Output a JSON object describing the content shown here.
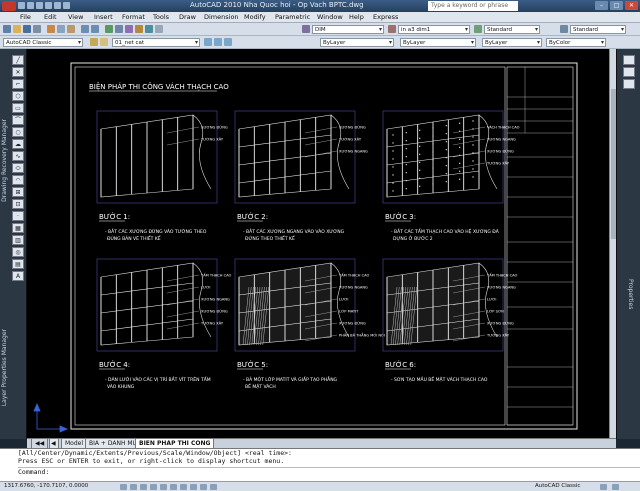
{
  "window": {
    "title": "AutoCAD 2010  Nha Quoc hoi - Op Vach BPTC.dwg",
    "search_placeholder": "Type a keyword or phrase",
    "minimize": "–",
    "maximize": "□",
    "close": "✕"
  },
  "menu": [
    "File",
    "Edit",
    "View",
    "Insert",
    "Format",
    "Tools",
    "Draw",
    "Dimension",
    "Modify",
    "Parametric",
    "Window",
    "Help",
    "Express"
  ],
  "toolbar": {
    "dimstyle": "DIM",
    "textstyle": "in a3 dim1",
    "tablestyle": "Standard",
    "mleaderstyle": "Standard",
    "workspace": "AutoCAD Classic",
    "layer": "01_net cat",
    "color": "ByLayer",
    "linetype": "ByLayer",
    "lineweight": "ByLayer",
    "plotstyle": "ByColor"
  },
  "palettes": {
    "left_top": "Drawing Recovery Manager",
    "left_bottom": "Layer Properties Manager",
    "right": "Properties",
    "text_tool": "A"
  },
  "drawing": {
    "sheet_title": "BIỆN PHÁP THI CÔNG VÁCH THẠCH CAO",
    "steps": [
      {
        "label": "BƯỚC 1:",
        "desc1": "- BẮT CÁC XƯƠNG ĐỨNG VÀO TƯỜNG THEO",
        "desc2": "ĐÚNG BẢN VẼ THIẾT KẾ",
        "callouts": [
          "XƯƠNG ĐỨNG",
          "TƯỜNG XÂY"
        ]
      },
      {
        "label": "BƯỚC 2:",
        "desc1": "- BẮT CÁC XƯƠNG NGANG VÀO VÀO XƯƠNG",
        "desc2": "ĐỨNG THEO THIẾT KẾ",
        "callouts": [
          "XƯƠNG ĐỨNG",
          "TƯỜNG XÂY",
          "XƯƠNG NGANG"
        ]
      },
      {
        "label": "BƯỚC 3:",
        "desc1": "- BẮT CÁC TẤM THẠCH CAO VÀO HỆ XƯƠNG ĐÃ",
        "desc2": "DỰNG Ở BƯỚC 2",
        "callouts": [
          "VÁCH THẠCH CAO",
          "XƯƠNG NGANG",
          "XƯƠNG ĐỨNG",
          "TƯỜNG XÂY"
        ]
      },
      {
        "label": "BƯỚC 4:",
        "desc1": "- DÁN LƯỚI VÀO CÁC VỊ TRÍ BẮT VÍT TRÊN TẤM",
        "desc2": "VÀO KHUNG",
        "callouts": [
          "TẤM THẠCH CAO",
          "LƯỚI",
          "XƯƠNG NGANG",
          "XƯƠNG ĐỨNG",
          "TƯỜNG XÂY"
        ]
      },
      {
        "label": "BƯỚC 5:",
        "desc1": "- BẢ MỘT LỚP MATIT VÀ GIẤP TẠO PHẲNG",
        "desc2": "BỀ MẶT VÁCH",
        "callouts": [
          "TẤM THẠCH CAO",
          "XƯƠNG NGANG",
          "LƯỚI",
          "LỚP MATIT",
          "XƯƠNG ĐỨNG",
          "PHẦN BẢ THẲNG MỐI NỐI"
        ]
      },
      {
        "label": "BƯỚC 6:",
        "desc1": "- SƠN TẠO MẦU BỀ MẶT VÁCH THẠCH CAO",
        "desc2": "",
        "callouts": [
          "TẤM THẠCH CAO",
          "XƯƠNG NGANG",
          "LƯỚI",
          "LỚP SƠN",
          "XƯƠNG ĐỨNG",
          "TƯỜNG XÂY"
        ]
      }
    ]
  },
  "layout_tabs": [
    "Model",
    "BIA + DANH MUC",
    "BIEN PHAP THI CONG"
  ],
  "command": {
    "line1": "[All/Center/Dynamic/Extents/Previous/Scale/Window/Object] <real time>:",
    "line2": "Press ESC or ENTER to exit, or right-click to display shortcut menu.",
    "prompt": "Command:"
  },
  "status": {
    "coords": "1317.6760, -170.7107, 0.0000",
    "workspace": "AutoCAD Classic"
  }
}
